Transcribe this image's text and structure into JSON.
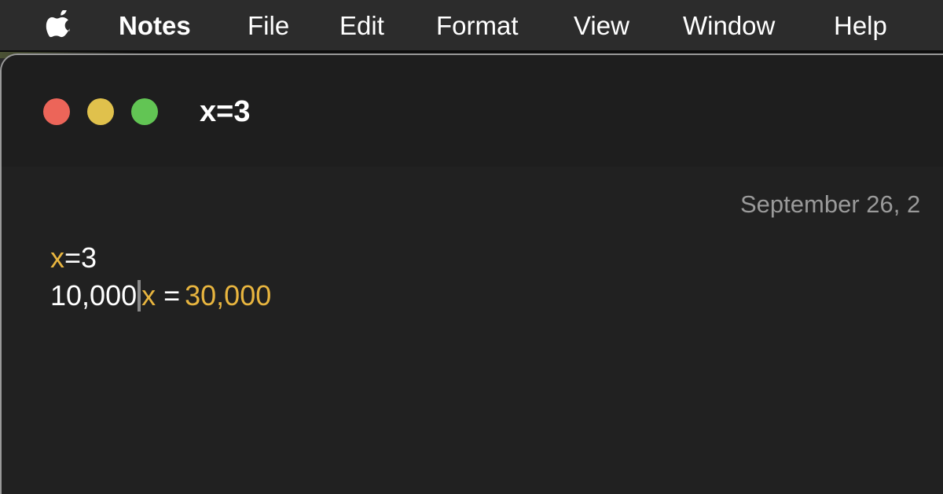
{
  "menubar": {
    "apple_icon": "apple-logo",
    "items": [
      {
        "label": "Notes",
        "bold": true
      },
      {
        "label": "File"
      },
      {
        "label": "Edit"
      },
      {
        "label": "Format"
      },
      {
        "label": "View"
      },
      {
        "label": "Window"
      },
      {
        "label": "Help"
      }
    ]
  },
  "window": {
    "title": "x=3",
    "traffic_lights": {
      "close_color": "#ec6559",
      "minimize_color": "#e0c14c",
      "zoom_color": "#62c554"
    }
  },
  "note": {
    "date": "September 26, 2",
    "lines": [
      {
        "variable": "x",
        "rest": "=3"
      },
      {
        "prefix": "10,000",
        "variable": "x",
        "operator": "=",
        "result": "30,000"
      }
    ],
    "accent_color": "#e8b53f"
  }
}
